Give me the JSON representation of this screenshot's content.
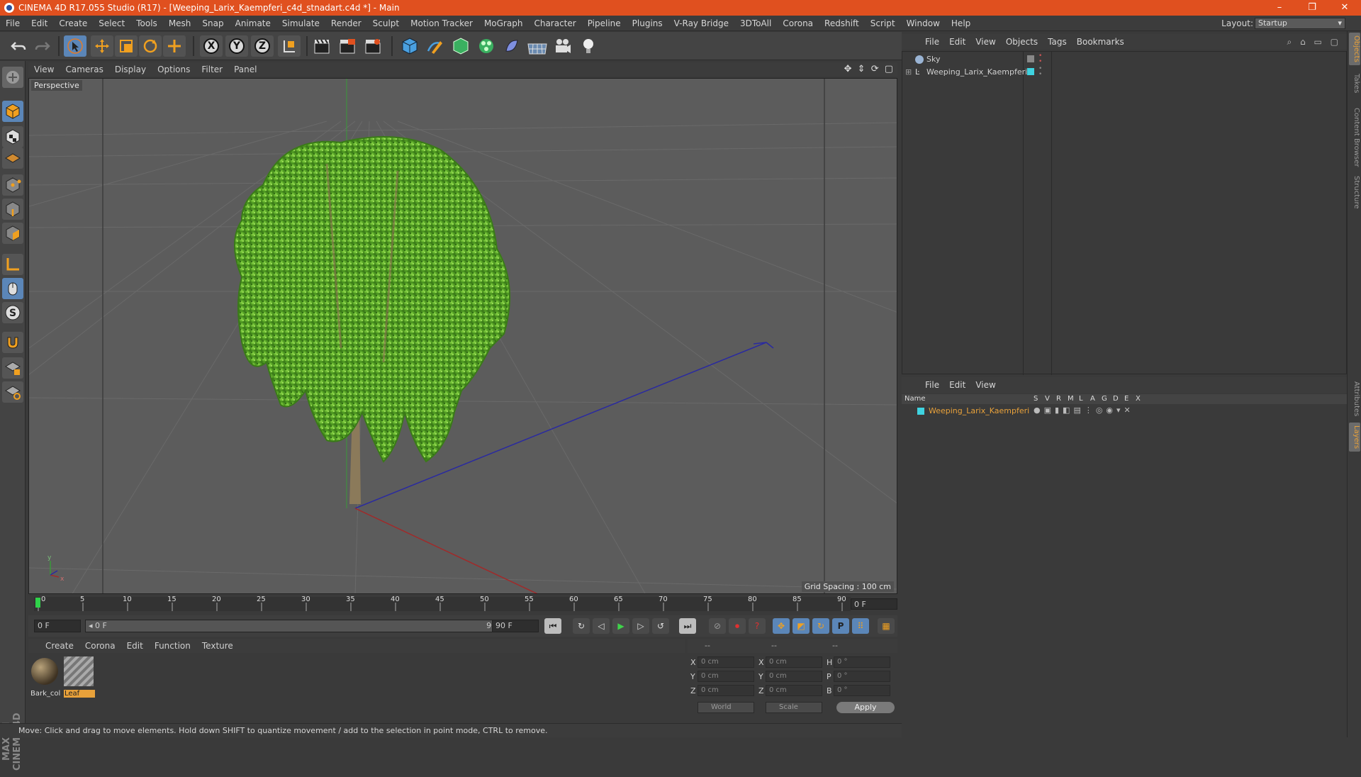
{
  "window": {
    "title": "CINEMA 4D R17.055 Studio (R17) - [Weeping_Larix_Kaempferi_c4d_stnadart.c4d *] - Main",
    "controls": [
      "–",
      "❐",
      "✕"
    ]
  },
  "menubar": {
    "items": [
      "File",
      "Edit",
      "Create",
      "Select",
      "Tools",
      "Mesh",
      "Snap",
      "Animate",
      "Simulate",
      "Render",
      "Sculpt",
      "Motion Tracker",
      "MoGraph",
      "Character",
      "Pipeline",
      "Plugins",
      "V-Ray Bridge",
      "3DToAll",
      "Corona",
      "Redshift",
      "Script",
      "Window",
      "Help"
    ],
    "layout_label": "Layout:",
    "layout_value": "Startup"
  },
  "viewport": {
    "menu": [
      "View",
      "Cameras",
      "Display",
      "Options",
      "Filter",
      "Panel"
    ],
    "label": "Perspective",
    "grid_spacing": "Grid Spacing : 100 cm"
  },
  "timeline": {
    "ticks": [
      "0",
      "5",
      "10",
      "15",
      "20",
      "25",
      "30",
      "35",
      "40",
      "45",
      "50",
      "55",
      "60",
      "65",
      "70",
      "75",
      "80",
      "85",
      "90"
    ],
    "current_frame": "0 F",
    "start_field": "0 F",
    "range_start": "◂ 0 F",
    "range_end": "90 F ▸",
    "end_field": "90 F"
  },
  "materials": {
    "menu": [
      "Create",
      "Corona",
      "Edit",
      "Function",
      "Texture"
    ],
    "items": [
      {
        "name": "Bark_col"
      },
      {
        "name": "Leaf"
      }
    ]
  },
  "coordinates": {
    "headers": [
      "--",
      "--",
      "--"
    ],
    "rows": [
      {
        "axis1": "X",
        "val1": "0 cm",
        "axis2": "X",
        "val2": "0 cm",
        "axis3": "H",
        "val3": "0 °"
      },
      {
        "axis1": "Y",
        "val1": "0 cm",
        "axis2": "Y",
        "val2": "0 cm",
        "axis3": "P",
        "val3": "0 °"
      },
      {
        "axis1": "Z",
        "val1": "0 cm",
        "axis2": "Z",
        "val2": "0 cm",
        "axis3": "B",
        "val3": "0 °"
      }
    ],
    "world_dropdown": "World",
    "scale_dropdown": "Scale",
    "apply": "Apply"
  },
  "status": {
    "text": "Move: Click and drag to move elements. Hold down SHIFT to quantize movement / add to the selection in point mode, CTRL to remove."
  },
  "object_manager": {
    "menu": [
      "File",
      "Edit",
      "View",
      "Objects",
      "Tags",
      "Bookmarks"
    ],
    "objects": [
      {
        "name": "Sky"
      },
      {
        "name": "Weeping_Larix_Kaempferi"
      }
    ]
  },
  "layer_manager": {
    "menu": [
      "File",
      "Edit",
      "View"
    ],
    "columns": [
      "Name",
      "S",
      "V",
      "R",
      "M",
      "L",
      "A",
      "G",
      "D",
      "E",
      "X"
    ],
    "layers": [
      {
        "name": "Weeping_Larix_Kaempferi",
        "color": "#3fd3e0"
      }
    ]
  },
  "right_tabs": {
    "top": [
      "Objects",
      "Takes",
      "Content Browser",
      "Structure"
    ],
    "bottom": [
      "Attributes",
      "Layers"
    ]
  },
  "branding": {
    "logo_text": "MAXON CINEMA 4D"
  },
  "colors": {
    "title_bar": "#e0501f",
    "selection_blue": "#5b86b8",
    "layer_orange": "#e8a13a",
    "foliage": "#6ab832"
  }
}
